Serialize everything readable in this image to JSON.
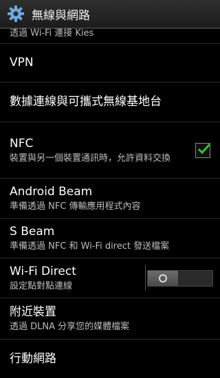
{
  "header": {
    "title": "無線與網路"
  },
  "items": [
    {
      "subtitle": "透過 Wi-Fi 連接 Kies"
    },
    {
      "title": "VPN"
    },
    {
      "title": "數據連線與可攜式無線基地台"
    },
    {
      "title": "NFC",
      "subtitle": "裝置與另一個裝置通訊時，允許資料交換",
      "checked": true
    },
    {
      "title": "Android Beam",
      "subtitle": "準備透過 NFC 傳輸應用程式內容"
    },
    {
      "title": "S Beam",
      "subtitle": "準備透過 NFC 和 Wi-Fi direct 發送檔案"
    },
    {
      "title": "Wi-Fi Direct",
      "subtitle": "設定點對點連線",
      "toggle_on": false
    },
    {
      "title": "附近裝置",
      "subtitle": "透過 DLNA 分享您的媒體檔案"
    },
    {
      "title": "行動網路"
    }
  ]
}
